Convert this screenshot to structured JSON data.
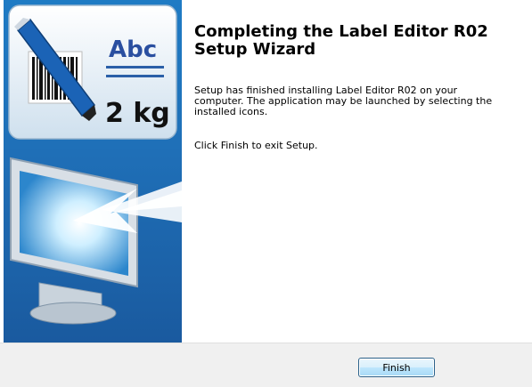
{
  "wizard": {
    "title": "Completing the Label Editor R02 Setup Wizard",
    "description": "Setup has finished installing Label Editor R02 on your computer. The application may be launched by selecting the installed icons.",
    "instruction": "Click Finish to exit Setup.",
    "finish_label": "Finish"
  },
  "banner": {
    "label_text": "Abc",
    "weight_text": "2 kg",
    "icons": [
      "barcode-icon",
      "pen-icon",
      "monitor-icon",
      "arrow-icon"
    ]
  },
  "colors": {
    "banner_blue": "#1f6fb7",
    "footer_bg": "#f0f0f0",
    "button_border": "#2c628b"
  }
}
